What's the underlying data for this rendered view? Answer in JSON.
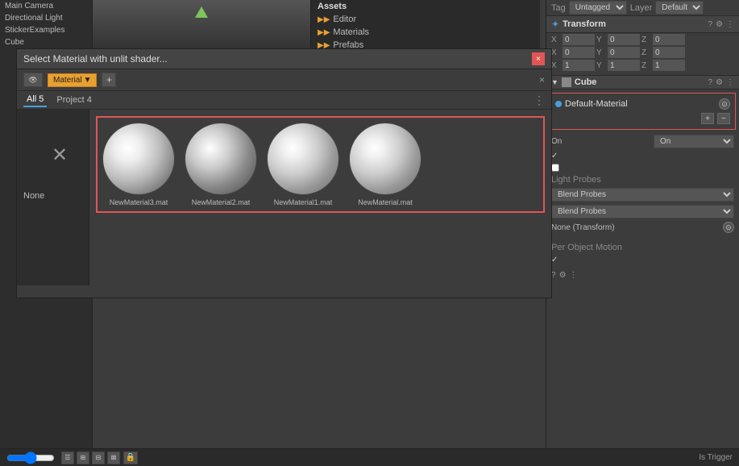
{
  "left_panel": {
    "items": [
      "Main Camera",
      "Directional Light",
      "StickerExamples",
      "Cube"
    ]
  },
  "viewport": {
    "has_triangle": true
  },
  "assets": {
    "title": "Assets",
    "folders": [
      "Editor",
      "Materials",
      "Prefabs"
    ]
  },
  "inspector": {
    "tag_label": "Tag",
    "tag_value": "Untagged",
    "layer_label": "Layer",
    "layer_value": "Default",
    "transform_title": "Transform",
    "position": {
      "x": "0",
      "y": "0",
      "z": "0"
    },
    "rotation": {
      "x": "0",
      "y": "0",
      "z": "0"
    },
    "scale": {
      "x": "1",
      "y": "1",
      "z": "1"
    },
    "mesh_renderer_title": "Cube",
    "material_name": "Default-Material",
    "on_label": "On",
    "light_probes_label": "Light Probes",
    "blend_probes_label1": "Blend Probes",
    "blend_probes_label2": "Blend Probes",
    "none_transform": "None (Transform)",
    "per_object_motion": "Per Object Motion",
    "checkmark": "✓"
  },
  "material_selector": {
    "title": "Select Material with unlit shader...",
    "close_label": "×",
    "toolbar": {
      "eye_icon": "👁",
      "material_dropdown_label": "Material",
      "plus_label": "+",
      "close_x": "×"
    },
    "tabs": {
      "all_label": "All",
      "all_count": "5",
      "project_label": "Project",
      "project_count": "4"
    },
    "none_label": "None",
    "materials": [
      {
        "name": "NewMaterial3.mat",
        "type": "bright"
      },
      {
        "name": "NewMaterial2.mat",
        "type": "lit"
      },
      {
        "name": "NewMaterial1.mat",
        "type": "default"
      },
      {
        "name": "NewMaterial.mat",
        "type": "default"
      }
    ]
  },
  "status_bar": {
    "is_trigger_label": "Is Trigger"
  }
}
